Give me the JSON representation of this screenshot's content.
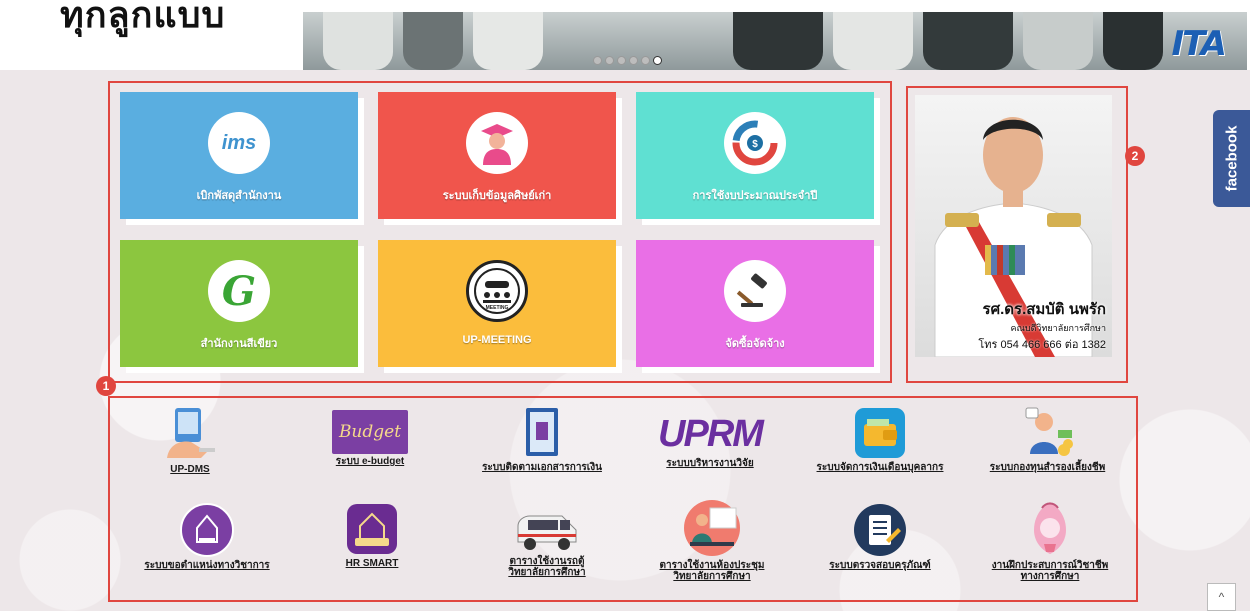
{
  "header": {
    "site_title": "ทุกลูกแบบ",
    "logo_text": "ITA",
    "carousel": {
      "slide_count": 6,
      "active_index": 5
    }
  },
  "tiles": [
    {
      "label": "เบิกพัสดุสำนักงาน",
      "icon": "ims-icon",
      "icon_text": "ims",
      "color": "#5aaee0"
    },
    {
      "label": "ระบบเก็บข้อมูลศิษย์เก่า",
      "icon": "graduate-icon",
      "color": "#f0554c"
    },
    {
      "label": "การใช้งบประมาณประจำปี",
      "icon": "budget-chart-icon",
      "color": "#5fe0d2"
    },
    {
      "label": "สำนักงานสีเขียว",
      "icon": "green-office-icon",
      "icon_text": "G",
      "color": "#8cc63f"
    },
    {
      "label": "UP-MEETING",
      "icon": "meeting-icon",
      "icon_text": "MEETING",
      "color": "#fbbd3c"
    },
    {
      "label": "จัดซื้อจัดจ้าง",
      "icon": "gavel-icon",
      "color": "#e96fe6"
    }
  ],
  "portrait": {
    "name": "รศ.ดร.สมบัติ นพรัก",
    "position": "คณบดีวิทยาลัยการศึกษา",
    "phone": "โทร 054 466 666 ต่อ 1382"
  },
  "badges": {
    "systems": "1",
    "portrait": "2"
  },
  "facebook_label": "facebook",
  "systems": [
    {
      "label": "UP-DMS",
      "icon": "dms-icon"
    },
    {
      "label": "ระบบ e-budget",
      "icon": "e-budget-icon",
      "icon_text": "Budget"
    },
    {
      "label": "ระบบติดตามเอกสารการเงิน",
      "icon": "finance-document-icon"
    },
    {
      "label": "ระบบบริหารงานวิจัย",
      "icon": "uprm-icon",
      "icon_text": "UPRM"
    },
    {
      "label": "ระบบจัดการเงินเดือนบุคลากร",
      "icon": "wallet-icon"
    },
    {
      "label": "ระบบกองทุนสำรองเลี้ยงชีพ",
      "icon": "provident-fund-icon"
    },
    {
      "label": "ระบบขอตำแหน่งทางวิชาการ",
      "icon": "academic-position-icon"
    },
    {
      "label": "HR SMART",
      "icon": "hr-smart-icon"
    },
    {
      "label": "ตารางใช้งานรถตู้\nวิทยาลัยการศึกษา",
      "icon": "van-icon"
    },
    {
      "label": "ตารางใช้งานห้องประชุม\nวิทยาลัยการศึกษา",
      "icon": "meeting-room-icon"
    },
    {
      "label": "ระบบตรวจสอบครุภัณฑ์",
      "icon": "checklist-icon"
    },
    {
      "label": "งานฝึกประสบการณ์วิชาชีพ\nทางการศึกษา",
      "icon": "internship-icon"
    }
  ],
  "scroll_top_label": "^"
}
